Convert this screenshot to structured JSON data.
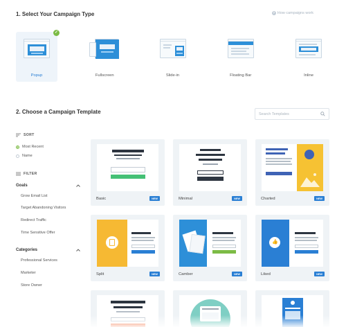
{
  "header": {
    "step1_title": "1. Select Your Campaign Type",
    "how_link": "How campaigns work",
    "step2_title": "2. Choose a Campaign Template"
  },
  "campaign_types": [
    {
      "label": "Popup",
      "selected": true
    },
    {
      "label": "Fullscreen",
      "selected": false
    },
    {
      "label": "Slide-in",
      "selected": false
    },
    {
      "label": "Floating Bar",
      "selected": false
    },
    {
      "label": "Inline",
      "selected": false
    }
  ],
  "search": {
    "placeholder": "Search Templates",
    "value": ""
  },
  "sidebar": {
    "sort_label": "SORT",
    "sort_options": [
      {
        "label": "Most Recent",
        "selected": true
      },
      {
        "label": "Name",
        "selected": false
      }
    ],
    "filter_label": "FILTER",
    "goals_title": "Goals",
    "goals": [
      "Grow Email List",
      "Target Abandoning Visitors",
      "Redirect Traffic",
      "Time Sensitive Offer"
    ],
    "categories_title": "Categories",
    "categories": [
      "Professional Services",
      "Marketer",
      "Store Owner"
    ]
  },
  "templates": [
    {
      "name": "Basic",
      "badge": "NEW"
    },
    {
      "name": "Minimal",
      "badge": "NEW"
    },
    {
      "name": "Charted",
      "badge": "NEW"
    },
    {
      "name": "Split",
      "badge": "NEW"
    },
    {
      "name": "Camber",
      "badge": "NEW"
    },
    {
      "name": "Liked",
      "badge": "NEW"
    }
  ],
  "colors": {
    "accent_blue": "#2a7fd4",
    "success_green": "#7cbb45",
    "card_bg": "#eff3f6",
    "dark_bar": "#2d3540"
  }
}
